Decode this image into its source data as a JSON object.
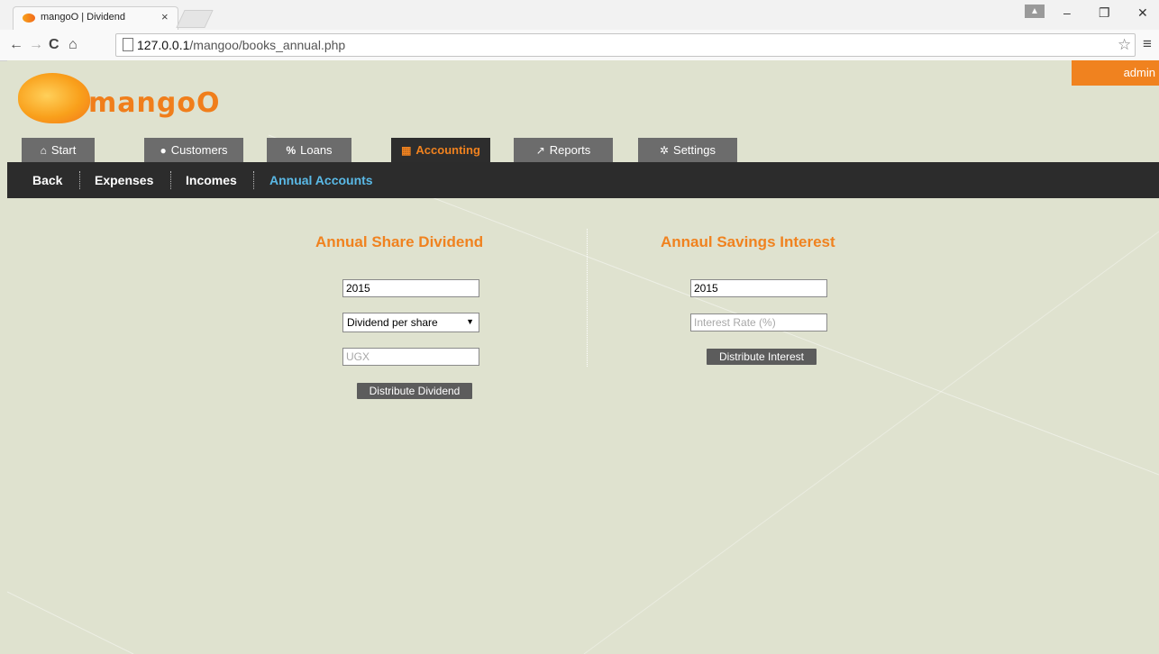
{
  "browser": {
    "tab_title": "mangoO | Dividend",
    "tab_close": "×",
    "url_host": "127.0.0.1",
    "url_path": "/mangoo/books_annual.php"
  },
  "header": {
    "logo_text": "mangoO",
    "user_label": "admin"
  },
  "main_tabs": [
    {
      "label": "Start",
      "icon": "home-icon"
    },
    {
      "label": "Customers",
      "icon": "user-icon"
    },
    {
      "label": "Loans",
      "icon": "percent-icon"
    },
    {
      "label": "Accounting",
      "icon": "calculator-icon",
      "active": true
    },
    {
      "label": "Reports",
      "icon": "chart-icon"
    },
    {
      "label": "Settings",
      "icon": "gear-icon"
    }
  ],
  "sub_nav": [
    {
      "label": "Back"
    },
    {
      "label": "Expenses"
    },
    {
      "label": "Incomes"
    },
    {
      "label": "Annual Accounts",
      "active": true
    }
  ],
  "dividend": {
    "title": "Annual Share Dividend",
    "year_value": "2015",
    "type_selected": "Dividend per share",
    "amount_placeholder": "UGX",
    "button_label": "Distribute Dividend"
  },
  "interest": {
    "title": "Annaul Savings Interest",
    "year_value": "2015",
    "rate_placeholder": "Interest Rate (%)",
    "button_label": "Distribute Interest"
  },
  "colors": {
    "accent": "#f0821f",
    "active_sub": "#5ab9e6",
    "nav_dark": "#2c2c2c",
    "page_bg": "#dfe2cf"
  }
}
